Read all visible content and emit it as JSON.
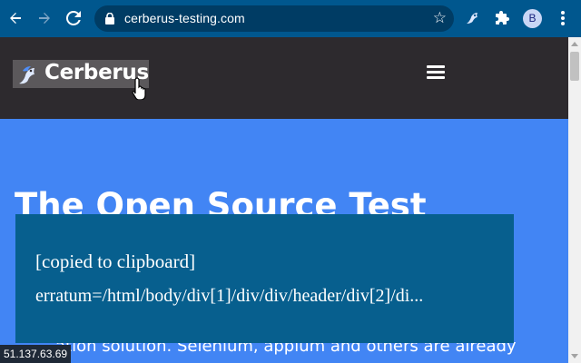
{
  "browser": {
    "url": "cerberus-testing.com",
    "profile_initial": "B",
    "icons": [
      "back-arrow-icon",
      "forward-arrow-icon",
      "reload-icon",
      "lock-icon",
      "star-icon",
      "cerberus-extension-icon",
      "puzzle-icon"
    ]
  },
  "site": {
    "brand": "Cerberus",
    "hero_title": "The Open Source Test",
    "hero_text_partial": "ation solution. Selenium, appium and others are already"
  },
  "overlay": {
    "line1": "[copied to clipboard]",
    "line2": "erratum=/html/body/div[1]/div/div/header/div[2]/di..."
  },
  "status": {
    "ip_fragment": "51.137.63.69"
  },
  "colors": {
    "toolbar": "#00578e",
    "omnibox": "#003c64",
    "site_header": "#2d2a2e",
    "hero": "#4285f4",
    "overlay": "#075f8e"
  }
}
